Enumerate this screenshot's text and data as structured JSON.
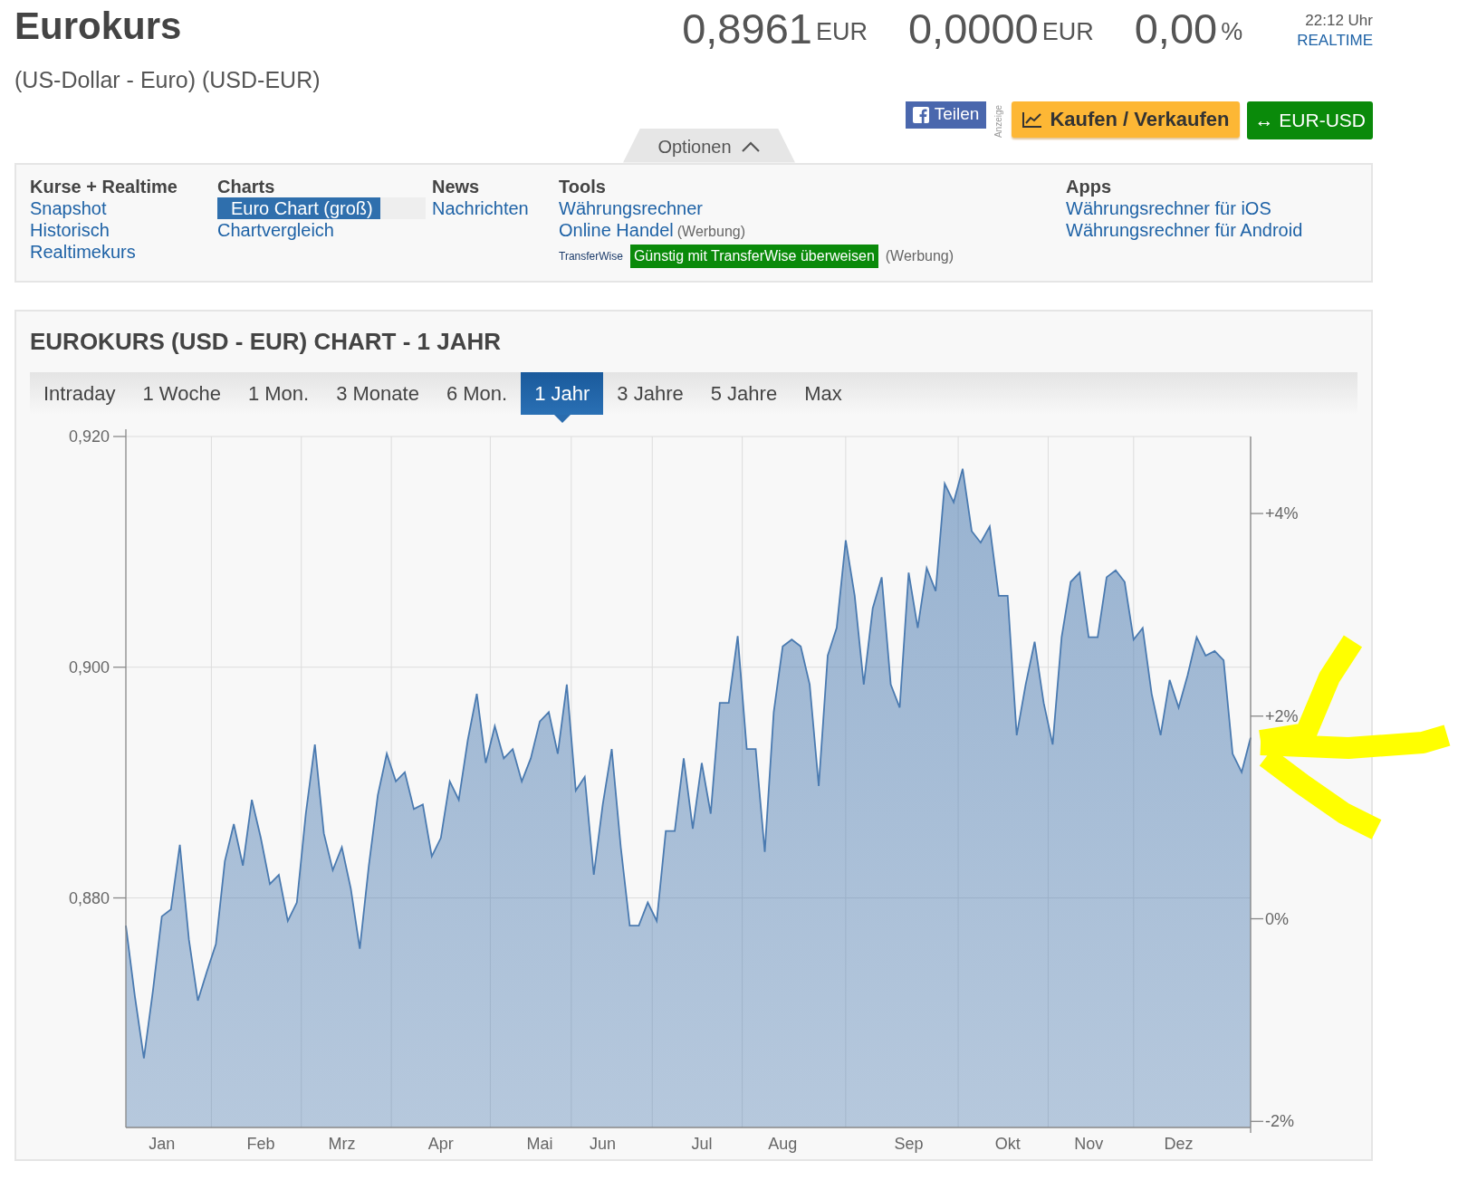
{
  "header": {
    "title": "Eurokurs",
    "subtitle": "(US-Dollar - Euro) (USD-EUR)",
    "quotes": [
      {
        "value": "0,8961",
        "unit": "EUR"
      },
      {
        "value": "0,0000",
        "unit": "EUR"
      },
      {
        "value": "0,00",
        "unit": "%"
      }
    ],
    "time": "22:12 Uhr",
    "realtime": "REALTIME"
  },
  "actions": [
    {
      "kind": "share",
      "label": "Teilen"
    },
    {
      "kind": "ad-label",
      "label": "Anzeige"
    },
    {
      "kind": "trade",
      "label": "Kaufen / Verkaufen"
    },
    {
      "kind": "switch",
      "label": "↔ EUR-USD"
    }
  ],
  "options": {
    "toggle": {
      "label": "Optionen",
      "expanded": true
    },
    "columns": [
      {
        "heading": "Kurse + Realtime",
        "links": [
          {
            "label": "Snapshot",
            "selected": false
          },
          {
            "label": "Historisch",
            "selected": false
          },
          {
            "label": "Realtimekurs",
            "selected": false
          }
        ]
      },
      {
        "heading": "Charts",
        "links": [
          {
            "label": "Euro Chart (groß)",
            "selected": true
          },
          {
            "label": "Chartvergleich",
            "selected": false
          }
        ]
      },
      {
        "heading": "News",
        "links": [
          {
            "label": "Nachrichten",
            "selected": false
          }
        ]
      },
      {
        "heading": "Tools",
        "links": [
          {
            "label": "Währungsrechner",
            "selected": false
          },
          {
            "label": "Online Handel",
            "note": "(Werbung)",
            "selected": false
          },
          {
            "kind": "promo",
            "logo": "TransferWise",
            "label": "Günstig mit TransferWise überweisen",
            "note": "(Werbung)",
            "selected": false
          }
        ]
      },
      {
        "heading": "Apps",
        "links": [
          {
            "label": "Währungsrechner für iOS",
            "selected": false
          },
          {
            "label": "Währungsrechner für Android",
            "selected": false
          }
        ]
      }
    ]
  },
  "chart": {
    "title": "EUROKURS (USD - EUR) CHART - 1 JAHR",
    "ranges": [
      {
        "label": "Intraday",
        "selected": false
      },
      {
        "label": "1 Woche",
        "selected": false
      },
      {
        "label": "1 Mon.",
        "selected": false
      },
      {
        "label": "3 Monate",
        "selected": false
      },
      {
        "label": "6 Mon.",
        "selected": false
      },
      {
        "label": "1 Jahr",
        "selected": true
      },
      {
        "label": "3 Jahre",
        "selected": false
      },
      {
        "label": "5 Jahre",
        "selected": false
      },
      {
        "label": "Max",
        "selected": false
      }
    ],
    "chart_data": {
      "type": "area",
      "categories": [
        null,
        null,
        null,
        null,
        "Jan",
        null,
        null,
        null,
        null,
        null,
        null,
        null,
        null,
        null,
        null,
        "Feb",
        null,
        null,
        null,
        null,
        null,
        null,
        null,
        null,
        "Mrz",
        null,
        null,
        null,
        null,
        null,
        null,
        null,
        null,
        null,
        null,
        "Apr",
        null,
        null,
        null,
        null,
        null,
        null,
        null,
        null,
        null,
        null,
        "Mai",
        null,
        null,
        null,
        null,
        null,
        null,
        "Jun",
        null,
        null,
        null,
        null,
        null,
        null,
        null,
        null,
        null,
        null,
        "Jul",
        null,
        null,
        null,
        null,
        null,
        null,
        null,
        null,
        "Aug",
        null,
        null,
        null,
        null,
        null,
        null,
        null,
        null,
        null,
        null,
        null,
        null,
        null,
        "Sep",
        null,
        null,
        null,
        null,
        null,
        null,
        null,
        null,
        null,
        null,
        "Okt",
        null,
        null,
        null,
        null,
        null,
        null,
        null,
        null,
        "Nov",
        null,
        null,
        null,
        null,
        null,
        null,
        null,
        null,
        null,
        "Dez",
        null,
        null,
        null,
        null,
        null,
        null,
        null,
        null
      ],
      "series": [
        {
          "color": "#4a7ab0",
          "values": [
            0.8776,
            0.8715,
            0.8661,
            0.8719,
            0.8784,
            0.879,
            0.8846,
            0.8764,
            0.8711,
            0.8736,
            0.876,
            0.8832,
            0.8864,
            0.8828,
            0.8885,
            0.8852,
            0.8812,
            0.882,
            0.878,
            0.8796,
            0.8873,
            0.8933,
            0.8856,
            0.8824,
            0.8844,
            0.8808,
            0.8756,
            0.8828,
            0.8889,
            0.8925,
            0.8901,
            0.8909,
            0.8877,
            0.8881,
            0.8836,
            0.8852,
            0.8901,
            0.8885,
            0.8937,
            0.8977,
            0.8917,
            0.8949,
            0.8921,
            0.8929,
            0.8901,
            0.8921,
            0.8953,
            0.8961,
            0.8925,
            0.8985,
            0.8893,
            0.8905,
            0.882,
            0.8881,
            0.8929,
            0.8844,
            0.8776,
            0.8776,
            0.8796,
            0.878,
            0.8858,
            0.8858,
            0.8921,
            0.886,
            0.8917,
            0.8873,
            0.8969,
            0.8969,
            0.9027,
            0.8929,
            0.8929,
            0.884,
            0.8961,
            0.9018,
            0.9024,
            0.9018,
            0.8985,
            0.8897,
            0.901,
            0.9034,
            0.911,
            0.9062,
            0.8985,
            0.9051,
            0.9078,
            0.8985,
            0.8965,
            0.9082,
            0.9034,
            0.9086,
            0.9066,
            0.9159,
            0.9143,
            0.9172,
            0.9118,
            0.9108,
            0.9122,
            0.9062,
            0.9062,
            0.8941,
            0.8985,
            0.9022,
            0.8969,
            0.8933,
            0.9026,
            0.9074,
            0.9082,
            0.9026,
            0.9026,
            0.9078,
            0.9084,
            0.9074,
            0.9024,
            0.9034,
            0.8977,
            0.8941,
            0.8989,
            0.8965,
            0.8993,
            0.9026,
            0.901,
            0.9014,
            0.9006,
            0.8925,
            0.8909,
            0.8939
          ]
        }
      ],
      "ylim": [
        0.8601,
        0.92
      ],
      "y2lim": [
        -2.06,
        4.76
      ],
      "yticks": [
        {
          "value": 0.88,
          "label": "0,880"
        },
        {
          "value": 0.9,
          "label": "0,900"
        },
        {
          "value": 0.92,
          "label": "0,920"
        }
      ],
      "y2ticks": [
        {
          "value": -2,
          "label": "-2%"
        },
        {
          "value": 0,
          "label": "0%"
        },
        {
          "value": 2,
          "label": "+2%"
        },
        {
          "value": 4,
          "label": "+4%"
        }
      ]
    }
  }
}
